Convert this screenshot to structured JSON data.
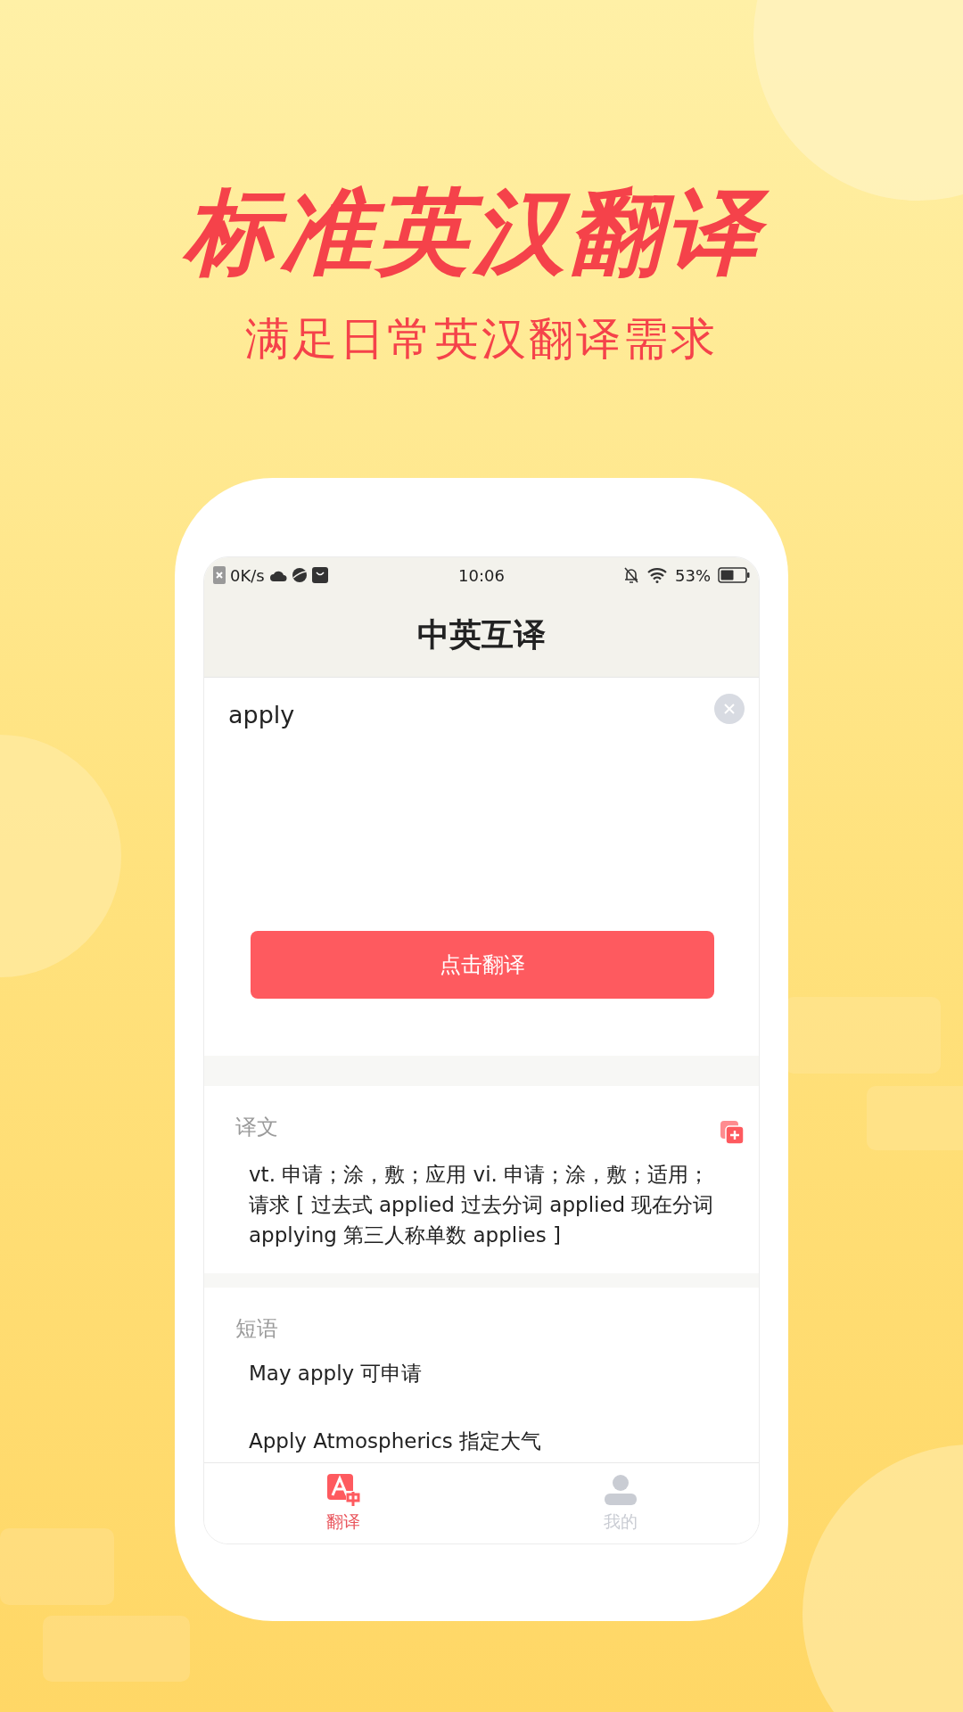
{
  "headline": "标准英汉翻译",
  "subtitle": "满足日常英汉翻译需求",
  "status_bar": {
    "speed": "0K/s",
    "time": "10:06",
    "battery": "53%"
  },
  "header": {
    "title": "中英互译"
  },
  "input": {
    "value": "apply"
  },
  "translate_button": "点击翻译",
  "translation": {
    "label": "译文",
    "text": "vt. 申请；涂，敷；应用 vi. 申请；涂，敷；适用；请求 [ 过去式 applied 过去分词 applied 现在分词 applying 第三人称单数 applies ]"
  },
  "phrases": {
    "label": "短语",
    "items": [
      "May apply 可申请",
      "Apply Atmospherics 指定大气"
    ]
  },
  "tabs": [
    {
      "label": "翻译",
      "kind": "translate",
      "selected": true
    },
    {
      "label": "我的",
      "kind": "profile",
      "selected": false
    }
  ]
}
